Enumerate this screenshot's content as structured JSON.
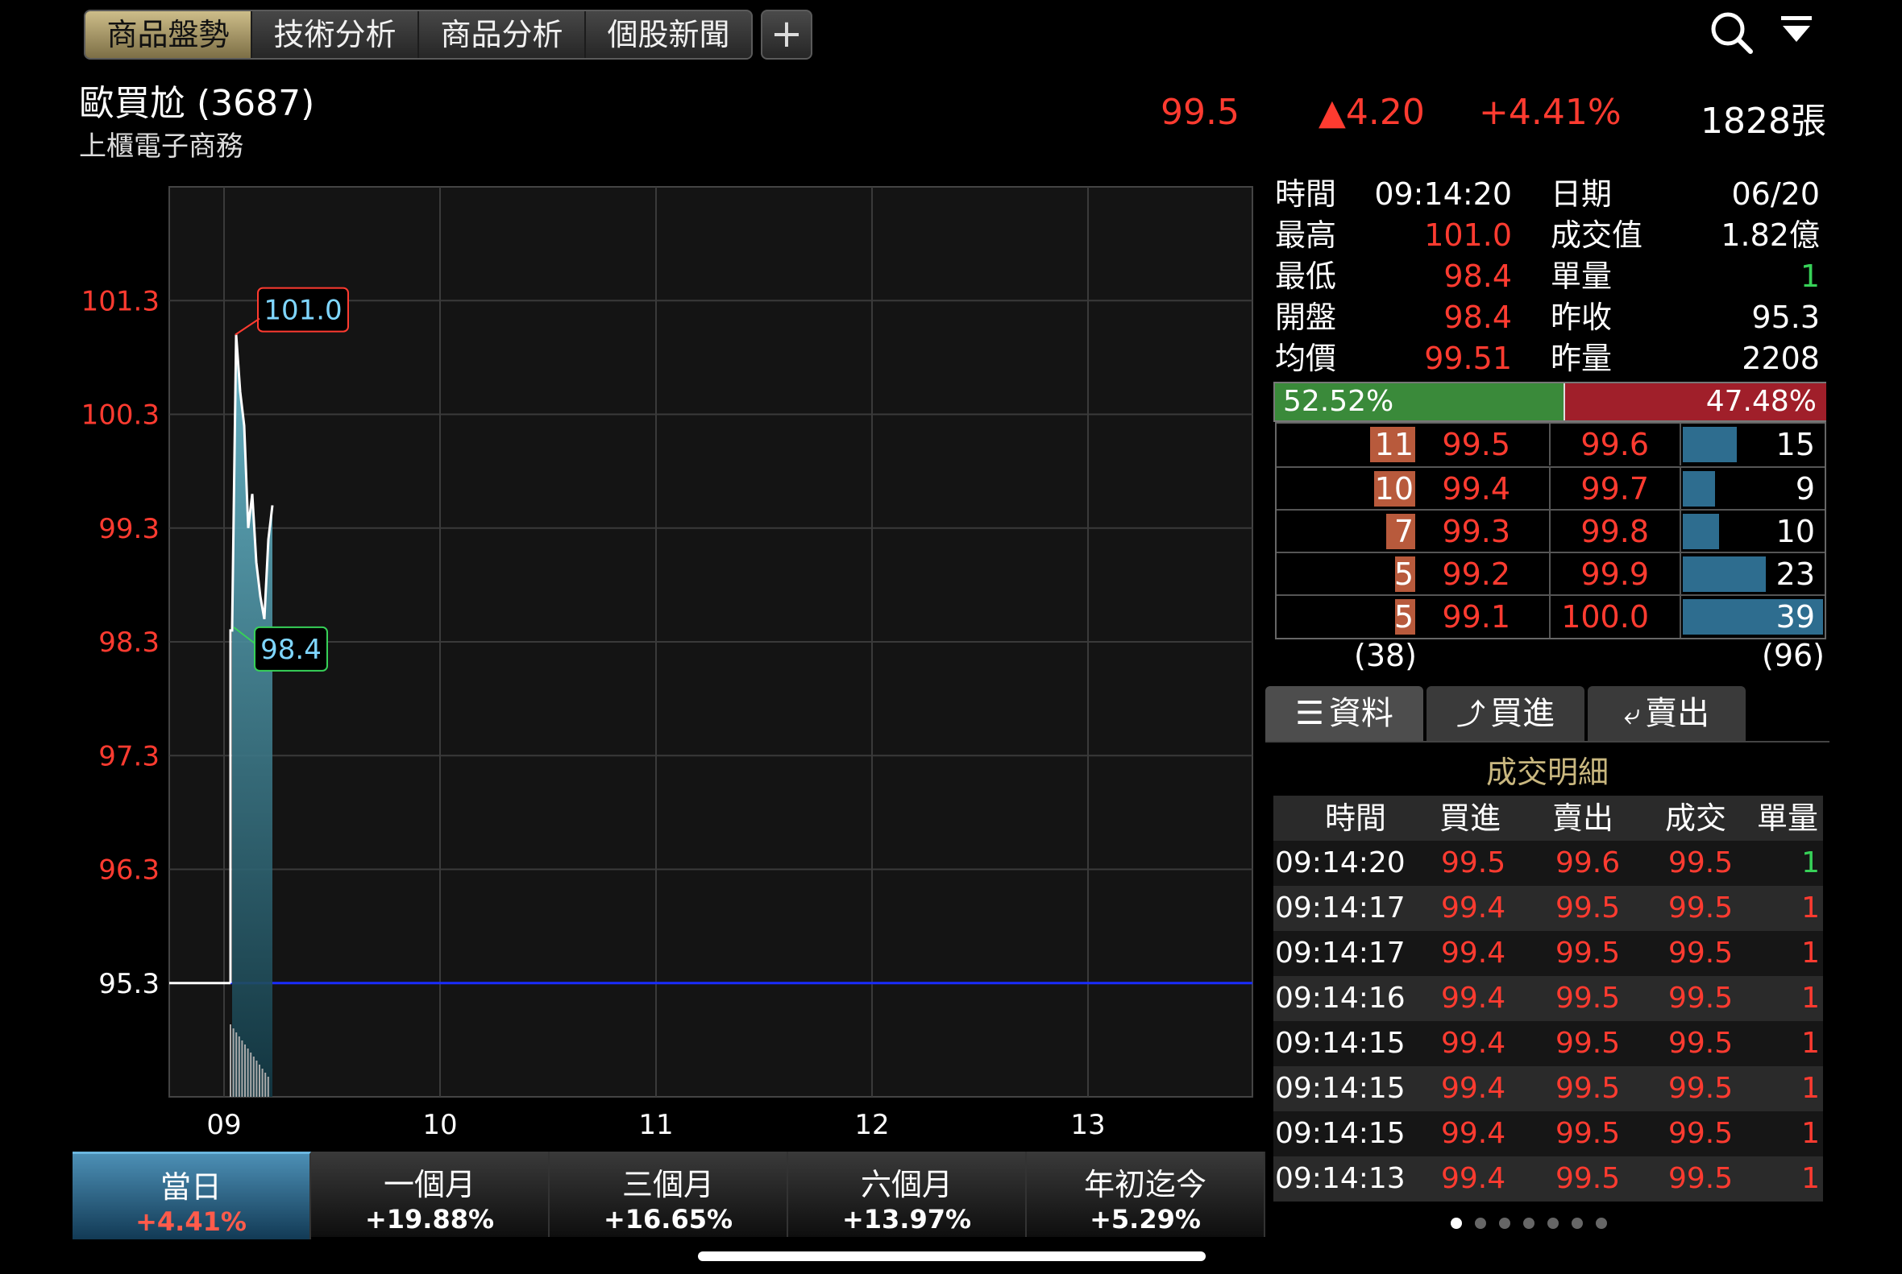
{
  "tabs": [
    {
      "label": "商品盤勢",
      "active": true
    },
    {
      "label": "技術分析",
      "active": false
    },
    {
      "label": "商品分析",
      "active": false
    },
    {
      "label": "個股新聞",
      "active": false
    }
  ],
  "add_tab_label": "+",
  "stock": {
    "name": "歐買尬 (3687)",
    "market": "上櫃電子商務"
  },
  "quote": {
    "price": "99.5",
    "change": "▲4.20",
    "change_pct": "+4.41%",
    "volume": "1828張"
  },
  "info": [
    {
      "l1": "時間",
      "v1": "09:14:20",
      "l2": "日期",
      "v2": "06/20"
    },
    {
      "l1": "最高",
      "v1": "101.0",
      "l2": "成交值",
      "v2": "1.82億"
    },
    {
      "l1": "最低",
      "v1": "98.4",
      "l2": "單量",
      "v2": "1"
    },
    {
      "l1": "開盤",
      "v1": "98.4",
      "l2": "昨收",
      "v2": "95.3"
    },
    {
      "l1": "均價",
      "v1": "99.51",
      "l2": "昨量",
      "v2": "2208"
    }
  ],
  "ratio": {
    "buy_pct": "52.52%",
    "sell_pct": "47.48%",
    "buy_fraction": 0.5252
  },
  "order_book": [
    {
      "bid_qty": "11",
      "bid": "99.5",
      "ask": "99.6",
      "ask_qty": "15"
    },
    {
      "bid_qty": "10",
      "bid": "99.4",
      "ask": "99.7",
      "ask_qty": "9"
    },
    {
      "bid_qty": "7",
      "bid": "99.3",
      "ask": "99.8",
      "ask_qty": "10"
    },
    {
      "bid_qty": "5",
      "bid": "99.2",
      "ask": "99.9",
      "ask_qty": "23"
    },
    {
      "bid_qty": "5",
      "bid": "99.1",
      "ask": "100.0",
      "ask_qty": "39"
    }
  ],
  "book_totals": {
    "bid_total": "(38)",
    "ask_total": "(96)"
  },
  "sub_tabs": [
    "資料",
    "買進",
    "賣出"
  ],
  "trade_section_title": "成交明細",
  "trade_headers": [
    "時間",
    "買進",
    "賣出",
    "成交",
    "單量"
  ],
  "trades": [
    {
      "time": "09:14:20",
      "bid": "99.5",
      "ask": "99.6",
      "price": "99.5",
      "qty": "1"
    },
    {
      "time": "09:14:17",
      "bid": "99.4",
      "ask": "99.5",
      "price": "99.5",
      "qty": "1"
    },
    {
      "time": "09:14:17",
      "bid": "99.4",
      "ask": "99.5",
      "price": "99.5",
      "qty": "1"
    },
    {
      "time": "09:14:16",
      "bid": "99.4",
      "ask": "99.5",
      "price": "99.5",
      "qty": "1"
    },
    {
      "time": "09:14:15",
      "bid": "99.4",
      "ask": "99.5",
      "price": "99.5",
      "qty": "1"
    },
    {
      "time": "09:14:15",
      "bid": "99.4",
      "ask": "99.5",
      "price": "99.5",
      "qty": "1"
    },
    {
      "time": "09:14:15",
      "bid": "99.4",
      "ask": "99.5",
      "price": "99.5",
      "qty": "1"
    },
    {
      "time": "09:14:13",
      "bid": "99.4",
      "ask": "99.5",
      "price": "99.5",
      "qty": "1"
    }
  ],
  "periods": [
    {
      "label": "當日",
      "pct": "+4.41%",
      "active": true
    },
    {
      "label": "一個月",
      "pct": "+19.88%",
      "active": false
    },
    {
      "label": "三個月",
      "pct": "+16.65%",
      "active": false
    },
    {
      "label": "六個月",
      "pct": "+13.97%",
      "active": false
    },
    {
      "label": "年初迄今",
      "pct": "+5.29%",
      "active": false
    }
  ],
  "colors": {
    "up": "#ff3b30",
    "down": "#37d158",
    "accent": "#c9b77f",
    "bid_bar": "#b85a3c",
    "ask_bar": "#2e6d8f"
  },
  "chart_data": {
    "type": "line",
    "y_ticks": [
      "101.3",
      "100.3",
      "99.3",
      "98.3",
      "97.3",
      "96.3",
      "95.3"
    ],
    "x_ticks": [
      "09",
      "10",
      "11",
      "12",
      "13"
    ],
    "ylim": [
      94.3,
      102.3
    ],
    "reference": 95.3,
    "high_label": "101.0",
    "low_label": "98.4",
    "x": [
      0.0,
      0.02,
      0.04,
      0.06,
      0.08,
      0.1,
      0.12,
      0.14,
      0.16,
      0.18,
      0.2
    ],
    "values": [
      98.4,
      101.0,
      100.5,
      100.2,
      99.3,
      99.6,
      99.0,
      98.7,
      98.5,
      99.2,
      99.5
    ]
  },
  "page_dots": 7
}
